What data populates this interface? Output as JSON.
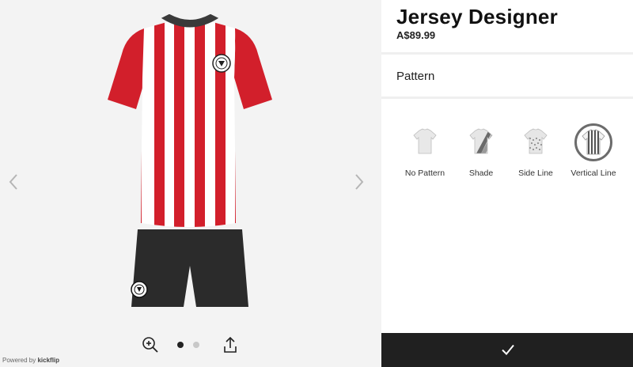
{
  "app": {
    "title": "Jersey Designer",
    "price": "A$89.99"
  },
  "section": {
    "title": "Pattern"
  },
  "pattern_options": [
    {
      "label": "No Pattern",
      "icon": "plain-jersey-icon",
      "selected": false
    },
    {
      "label": "Shade",
      "icon": "shade-jersey-icon",
      "selected": false
    },
    {
      "label": "Side Line",
      "icon": "side-line-jersey-icon",
      "selected": false
    },
    {
      "label": "Vertical Line",
      "icon": "vertical-line-jersey-icon",
      "selected": true
    }
  ],
  "preview": {
    "slides": 2,
    "active_slide": 1,
    "jersey_colors": {
      "primary": "#d21f2b",
      "secondary": "#ffffff",
      "collar": "#3a3a3a",
      "shorts": "#2b2b2b"
    }
  },
  "footer": {
    "powered_prefix": "Powered by ",
    "brand": "kickflip"
  },
  "confirm": {
    "icon": "checkmark-icon"
  }
}
